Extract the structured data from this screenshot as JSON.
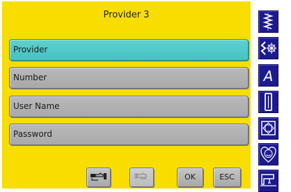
{
  "title": "Provider 3",
  "fields": [
    {
      "label": "Provider",
      "active": true
    },
    {
      "label": "Number",
      "active": false
    },
    {
      "label": "User Name",
      "active": false
    },
    {
      "label": "Password",
      "active": false
    }
  ],
  "buttons": {
    "ok_label": "OK",
    "esc_label": "ESC"
  },
  "sidebar": {
    "icons": [
      "zigzag-stitch-icon",
      "decorative-stitch-icon",
      "alphabet-icon",
      "buttonhole-icon",
      "quilt-icon",
      "embroidery-icon",
      "sewing-machine-icon"
    ],
    "alphabet_glyph": "A"
  },
  "colors": {
    "panel": "#f8dd00",
    "active_field": "#45c3c2",
    "field": "#adadad",
    "sidebar_button": "#1c1a8f"
  }
}
